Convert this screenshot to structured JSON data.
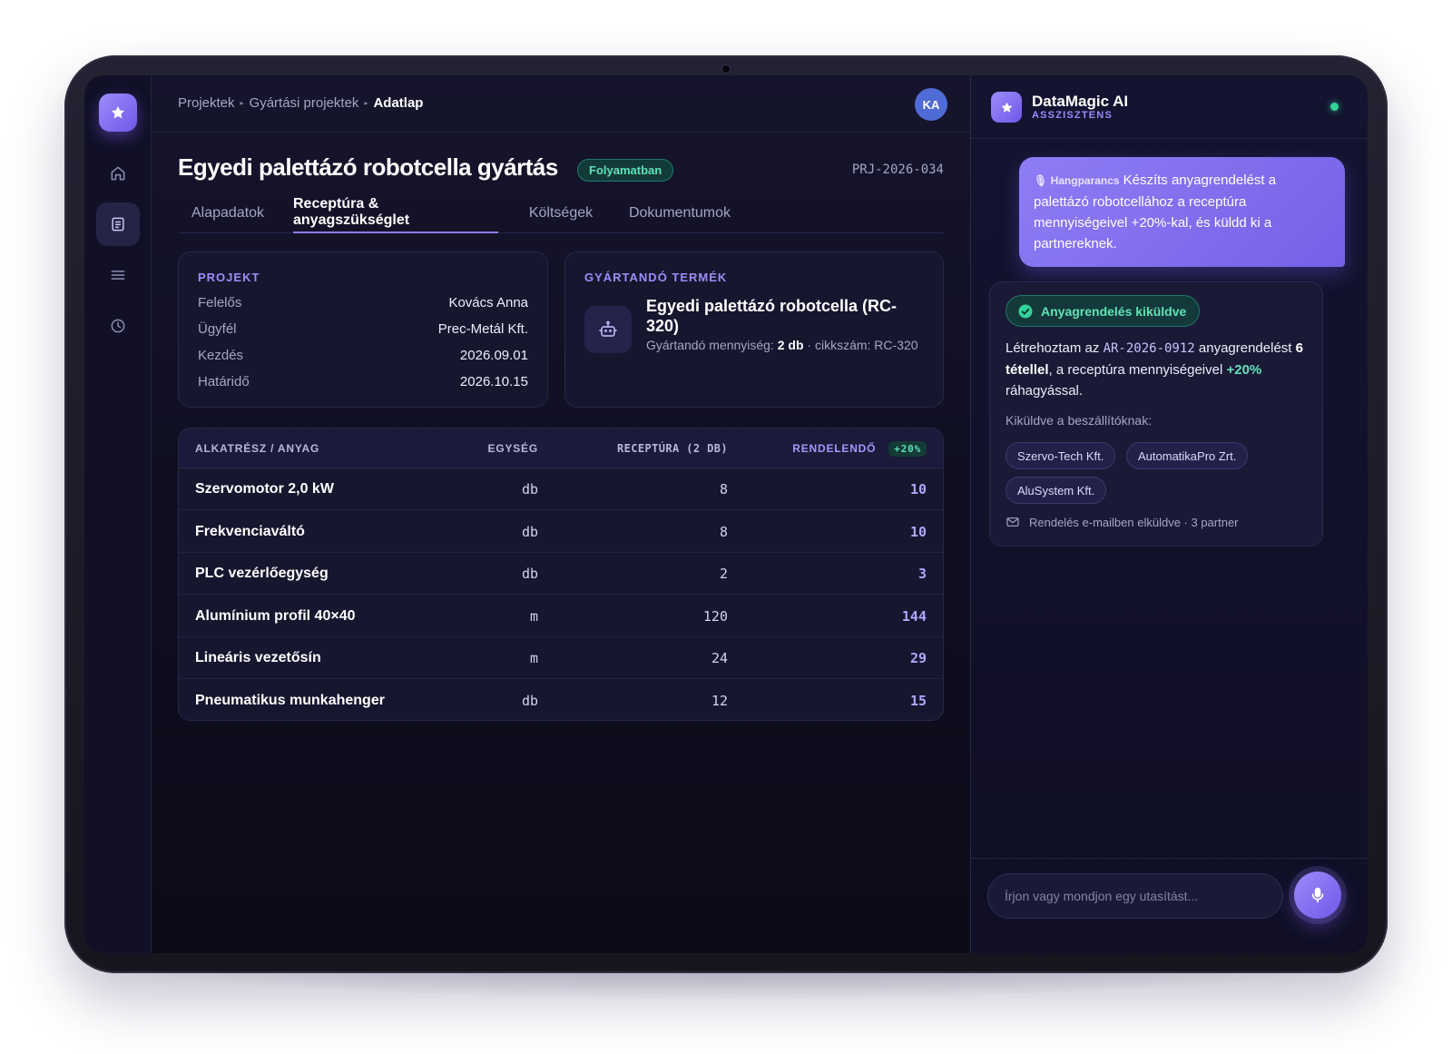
{
  "breadcrumb": {
    "items": [
      "Projektek",
      "Gyártási projektek"
    ],
    "current": "Adatlap"
  },
  "user": {
    "initials": "KA"
  },
  "project": {
    "title": "Egyedi palettázó robotcella gyártás",
    "status": "Folyamatban",
    "id": "PRJ-2026-034"
  },
  "tabs": [
    {
      "label": "Alapadatok"
    },
    {
      "label": "Receptúra & anyagszükséglet",
      "active": true
    },
    {
      "label": "Költségek"
    },
    {
      "label": "Dokumentumok"
    }
  ],
  "project_card": {
    "label": "PROJEKT",
    "rows": [
      {
        "key": "Felelős",
        "value": "Kovács Anna"
      },
      {
        "key": "Ügyfél",
        "value": "Prec-Metál Kft."
      },
      {
        "key": "Kezdés",
        "value": "2026.09.01"
      },
      {
        "key": "Határidő",
        "value": "2026.10.15"
      }
    ]
  },
  "product_card": {
    "label": "GYÁRTANDÓ TERMÉK",
    "name": "Egyedi palettázó robotcella (RC-320)",
    "qty_label": "Gyártandó mennyiség:",
    "qty_value": "2 db",
    "sku_text": "· cikkszám: RC-320"
  },
  "materials_table": {
    "headers": {
      "name": "ALKATRÉSZ / ANYAG",
      "unit": "EGYSÉG",
      "recipe": "RECEPTÚRA (2 DB)",
      "order": "RENDELENDŐ",
      "order_badge": "+20%"
    },
    "rows": [
      {
        "name": "Szervomotor 2,0 kW",
        "unit": "db",
        "recipe": "8",
        "order": "10"
      },
      {
        "name": "Frekvenciaváltó",
        "unit": "db",
        "recipe": "8",
        "order": "10"
      },
      {
        "name": "PLC vezérlőegység",
        "unit": "db",
        "recipe": "2",
        "order": "3"
      },
      {
        "name": "Alumínium profil 40×40",
        "unit": "m",
        "recipe": "120",
        "order": "144"
      },
      {
        "name": "Lineáris vezetősín",
        "unit": "m",
        "recipe": "24",
        "order": "29"
      },
      {
        "name": "Pneumatikus munkahenger",
        "unit": "db",
        "recipe": "12",
        "order": "15"
      }
    ]
  },
  "assistant": {
    "name": "DataMagic AI",
    "subtitle": "ASSZISZTENS",
    "user_message": {
      "tag": "Hangparancs",
      "text": "Készíts anyagrendelést a palettázó robotcellához a receptúra mennyiségeivel +20%-kal, és küldd ki a partnereknek."
    },
    "response": {
      "badge": "Anyagrendelés kiküldve",
      "t1": "Létrehoztam az ",
      "order_id": "AR-2026-0912",
      "t2": " anyagrendelést ",
      "items_bold": "6 tétellel",
      "t3": ", a receptúra mennyiségeivel ",
      "pct": "+20%",
      "t4": " ráhagyással.",
      "sent_label": "Kiküldve a beszállítóknak:",
      "suppliers": [
        "Szervo-Tech Kft.",
        "AutomatikaPro Zrt.",
        "AluSystem Kft."
      ],
      "mail_note": "Rendelés e-mailben elküldve · 3 partner"
    },
    "input_placeholder": "Írjon vagy mondjon egy utasítást..."
  },
  "icons": {
    "logo": "star-icon",
    "rail": [
      "home-icon",
      "document-icon",
      "menu-icon",
      "clock-icon"
    ],
    "product": "robot-icon",
    "check": "check-circle-icon",
    "mail": "mail-icon",
    "mic": "microphone-icon"
  },
  "colors": {
    "accent": "#8e7cf6",
    "success": "#5ee3b8",
    "background": "#0f0e20"
  }
}
